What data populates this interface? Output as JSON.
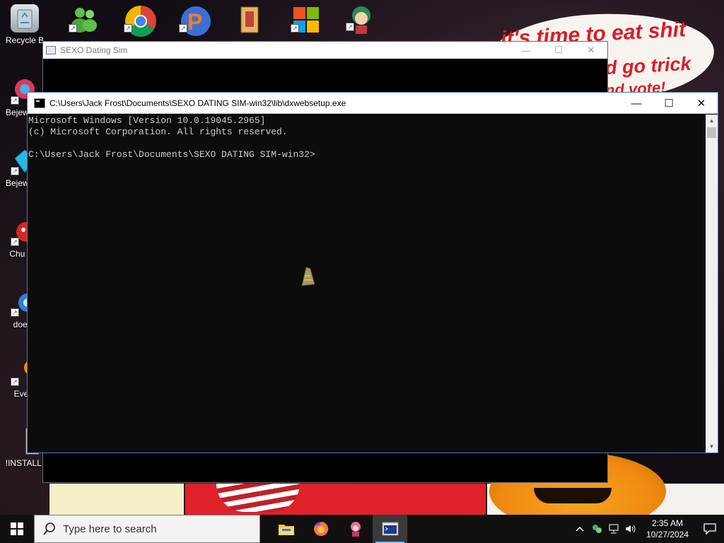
{
  "wallpaper": {
    "line1": "it's time to eat shit",
    "line2": "d go trick",
    "line3": "nd vote!"
  },
  "desktop_icons": [
    {
      "label": "Recycle B",
      "icon": "recycle-bin-icon"
    },
    {
      "label": "Bejew Del",
      "icon": "bejeweled-icon"
    },
    {
      "label": "Bejew Del",
      "icon": "bejeweled-gem-icon"
    },
    {
      "label": "Chu Del",
      "icon": "chuzzle-icon"
    },
    {
      "label": "doesn",
      "icon": "app-icon"
    },
    {
      "label": "Every",
      "icon": "app-icon"
    },
    {
      "label": "!INSTALLI",
      "icon": "text-file-icon"
    }
  ],
  "back_window": {
    "title": "SEXO Dating Sim",
    "minimize": "—",
    "maximize": "☐",
    "close": "✕"
  },
  "console_window": {
    "title": "C:\\Users\\Jack Frost\\Documents\\SEXO DATING SIM-win32\\lib\\dxwebsetup.exe",
    "minimize": "—",
    "maximize": "☐",
    "close": "✕",
    "lines": [
      "Microsoft Windows [Version 10.0.19045.2965]",
      "(c) Microsoft Corporation. All rights reserved.",
      "",
      "C:\\Users\\Jack Frost\\Documents\\SEXO DATING SIM-win32>"
    ]
  },
  "taskbar": {
    "search_placeholder": "Type here to search",
    "time": "2:35 AM",
    "date": "10/27/2024",
    "apps": [
      "file-explorer-icon",
      "firefox-icon",
      "game-icon",
      "console-app-icon"
    ]
  }
}
